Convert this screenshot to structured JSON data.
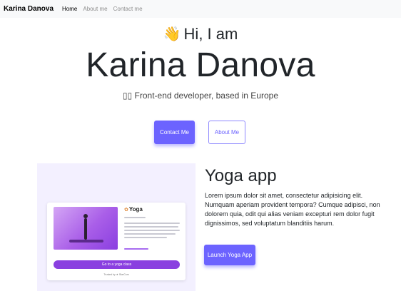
{
  "navbar": {
    "brand": "Karina Danova",
    "links": [
      "Home",
      "About me",
      "Contact me"
    ]
  },
  "hero": {
    "wave_icon": "waving-hand-icon",
    "greeting_icon_glyph": "👋",
    "greeting": "Hi, I am",
    "name": "Karina Danova",
    "subtitle": "▯▯ Front-end developer, based in Europe",
    "contact_button": "Contact Me",
    "about_button": "About Me"
  },
  "project": {
    "title": "Yoga app",
    "description": "Lorem ipsum dolor sit amet, consectetur adipisicing elit. Numquam aperiam provident tempora? Cumque adipisci, non dolorem quia, odit qui alias veniam excepturi rem dolor fugit dignissimos, sed voluptatum blanditiis harum.",
    "launch_button": "Launch Yoga App",
    "preview": {
      "logo": "Yoga",
      "cta": "Go to a yoga class",
      "footer": "Trusted by ★ StarCom"
    }
  },
  "colors": {
    "accent": "#6c63ff",
    "navbar_bg": "#f8f9fa",
    "preview_bg": "#f3f0ff",
    "yoga_purple": "#8a3fe0"
  }
}
